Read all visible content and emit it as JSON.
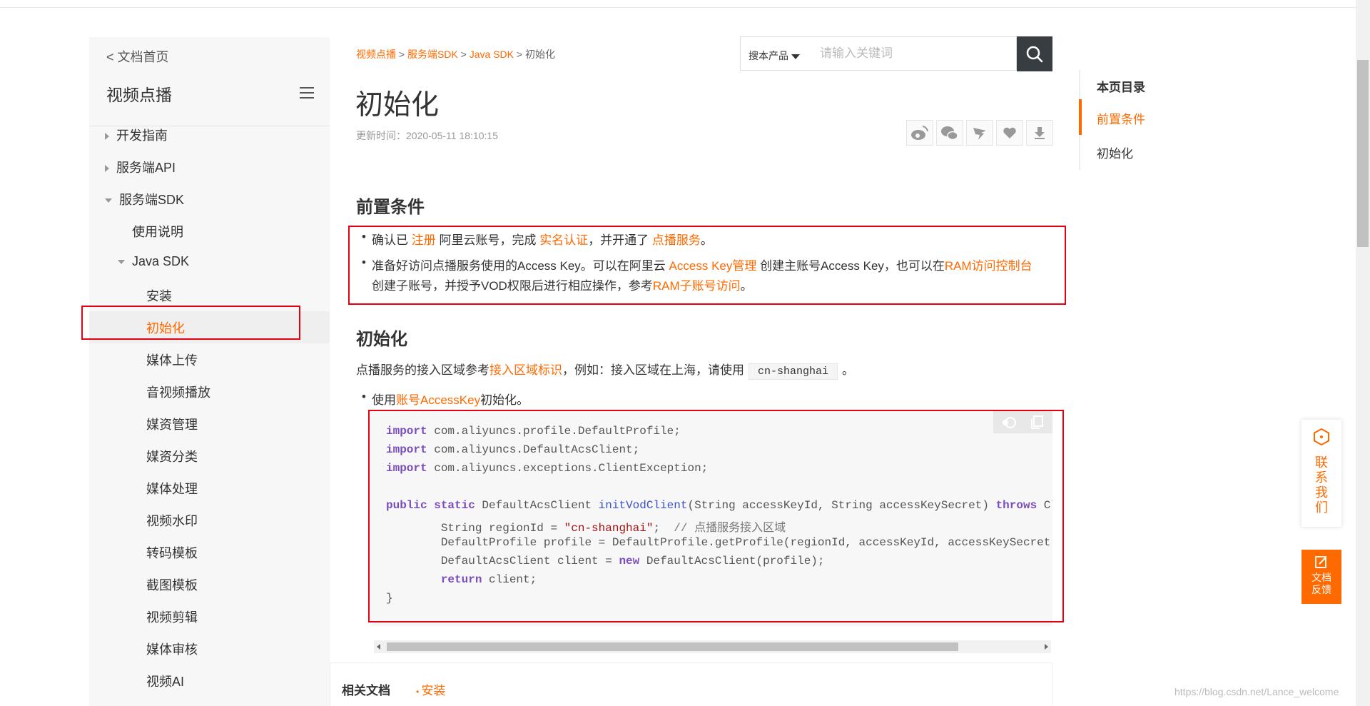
{
  "sidebar": {
    "back_label": "< 文档首页",
    "title": "视频点播",
    "items": [
      {
        "label": "开发指南"
      },
      {
        "label": "服务端API"
      },
      {
        "label": "服务端SDK"
      },
      {
        "label": "使用说明"
      },
      {
        "label": "Java SDK"
      },
      {
        "label": "安装"
      },
      {
        "label": "初始化"
      },
      {
        "label": "媒体上传"
      },
      {
        "label": "音视频播放"
      },
      {
        "label": "媒资管理"
      },
      {
        "label": "媒资分类"
      },
      {
        "label": "媒体处理"
      },
      {
        "label": "视频水印"
      },
      {
        "label": "转码模板"
      },
      {
        "label": "截图模板"
      },
      {
        "label": "视频剪辑"
      },
      {
        "label": "媒体审核"
      },
      {
        "label": "视频AI"
      }
    ]
  },
  "breadcrumb": {
    "items": [
      "视频点播",
      "服务端SDK",
      "Java SDK"
    ],
    "separator": ">",
    "current": "初始化"
  },
  "search": {
    "scope_label": "搜本产品",
    "placeholder": "请输入关键词"
  },
  "article": {
    "title": "初始化",
    "update_time": "更新时间：2020-05-11 18:10:15",
    "section1_title": "前置条件",
    "bullet1": {
      "t1": "确认已 ",
      "link1": "注册",
      "t2": " 阿里云账号，完成 ",
      "link2": "实名认证",
      "t3": "，并开通了 ",
      "link3": "点播服务",
      "t4": "。"
    },
    "bullet2": {
      "t1": "准备好访问点播服务使用的Access Key。可以在阿里云 ",
      "link1": "Access Key管理",
      "t2": " 创建主账号Access Key，也可以在",
      "link2": "RAM访问控制台",
      "t3": "创建子账号，并授予VOD权限后进行相应操作，参考",
      "link3": "RAM子账号访问",
      "t4": "。"
    },
    "section2_title": "初始化",
    "para": {
      "t1": "点播服务的接入区域参考",
      "link1": "接入区域标识",
      "t2": "，例如：接入区域在上海，请使用",
      "code": "cn-shanghai",
      "t3": "。"
    },
    "bullet3": {
      "t1": "使用",
      "link1": "账号AccessKey",
      "t2": "初始化。"
    }
  },
  "code": {
    "import1_kw": "import",
    "import1_rest": " com.aliyuncs.profile.DefaultProfile;",
    "import2_kw": "import",
    "import2_rest": " com.aliyuncs.DefaultAcsClient;",
    "import3_kw": "import",
    "import3_rest": " com.aliyuncs.exceptions.ClientException;",
    "sig_kw1": "public",
    "sig_kw2": "static",
    "sig_type": " DefaultAcsClient ",
    "sig_fn": "initVodClient",
    "sig_params": "(String accessKeyId, String accessKeySecret) ",
    "sig_throws": "throws",
    "sig_tail": " ClientException {",
    "l1_a": "        String regionId = ",
    "l1_str": "\"cn-shanghai\"",
    "l1_b": ";  ",
    "l1_cm": "// 点播服务接入区域",
    "l2": "        DefaultProfile profile = DefaultProfile.getProfile(regionId, accessKeyId, accessKeySecret);",
    "l3_a": "        DefaultAcsClient client = ",
    "l3_kw": "new",
    "l3_b": " DefaultAcsClient(profile);",
    "l4_kw": "return",
    "l4_b": " client;",
    "close": "}"
  },
  "related": {
    "title": "相关文档",
    "link": "安装"
  },
  "toc": {
    "title": "本页目录",
    "items": [
      "前置条件",
      "初始化"
    ]
  },
  "float": {
    "contact": "联系我们",
    "feedback_line1": "文档",
    "feedback_line2": "反馈"
  },
  "watermark": "https://blog.csdn.net/Lance_welcome",
  "colors": {
    "accent": "#ff6a00",
    "annotation": "#e60012"
  }
}
